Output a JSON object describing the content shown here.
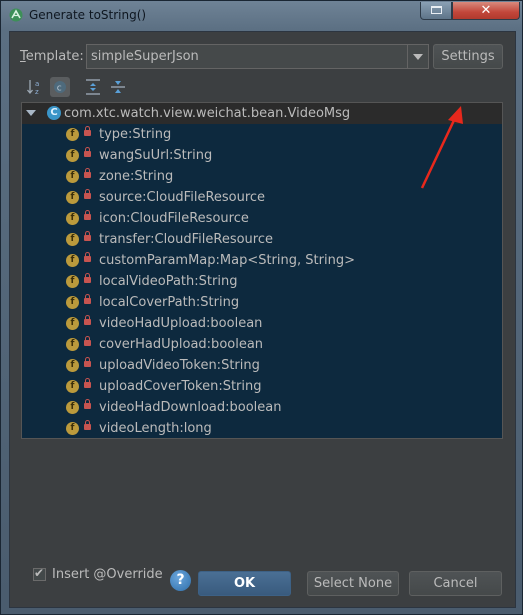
{
  "window": {
    "title": "Generate toString()"
  },
  "template": {
    "label_pre": "T",
    "label_ul": "emplate",
    "label_post": ":",
    "value": "simpleSuperJson",
    "settings_label": "Settings"
  },
  "tree": {
    "root_icon": "C",
    "root_label": "com.xtc.watch.view.weichat.bean.VideoMsg",
    "field_icon": "f",
    "fields": [
      "type:String",
      "wangSuUrl:String",
      "zone:String",
      "source:CloudFileResource",
      "icon:CloudFileResource",
      "transfer:CloudFileResource",
      "customParamMap:Map<String, String>",
      "localVideoPath:String",
      "localCoverPath:String",
      "videoHadUpload:boolean",
      "coverHadUpload:boolean",
      "uploadVideoToken:String",
      "uploadCoverToken:String",
      "videoHadDownload:boolean",
      "videoLength:long"
    ]
  },
  "footer": {
    "insert_override_label": "Insert @Override",
    "insert_override_checked": true,
    "checkmark": "✔",
    "help_glyph": "?",
    "ok_label": "OK",
    "select_none_label": "Select None",
    "cancel_label": "Cancel"
  },
  "colors": {
    "selection": "#0d293e",
    "annotation_arrow": "#e8281c",
    "field_icon": "#bb9a3c",
    "class_icon": "#3a95c8"
  }
}
